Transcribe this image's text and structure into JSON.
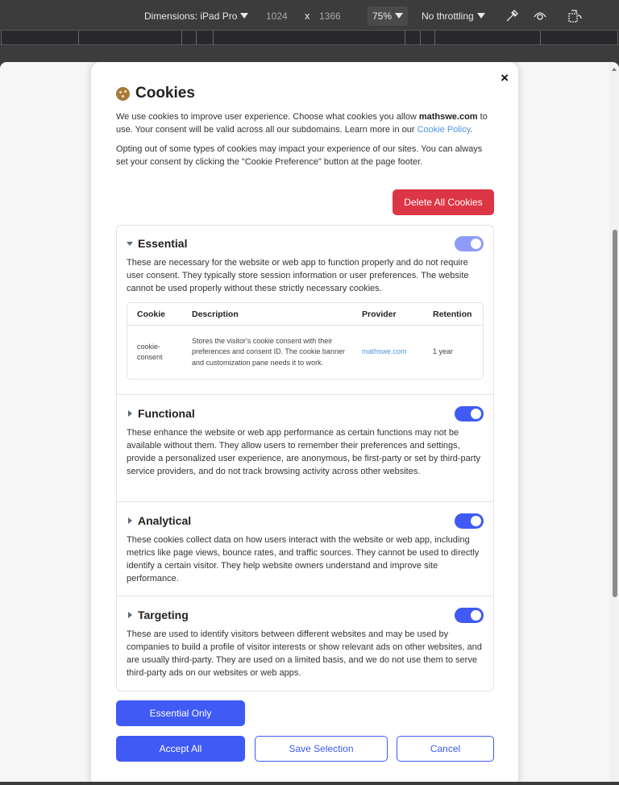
{
  "devtools": {
    "dimensions_label": "Dimensions: iPad Pro",
    "width": "1024",
    "times": "x",
    "height": "1366",
    "zoom": "75%",
    "throttling": "No throttling"
  },
  "modal": {
    "title": "Cookies",
    "close_label": "×",
    "intro_1_a": "We use cookies to improve user experience. Choose what cookies you allow ",
    "intro_1_domain": "mathswe.com",
    "intro_1_b": " to use. Your consent will be valid across all our subdomains. Learn more in our ",
    "intro_1_link": "Cookie Policy",
    "intro_1_c": ".",
    "intro_2": "Opting out of some types of cookies may impact your experience of our sites. You can always set your consent by clicking the \"Cookie Preference\" button at the page footer.",
    "delete_button": "Delete All Cookies",
    "categories": [
      {
        "name": "Essential",
        "expanded": true,
        "enabled": true,
        "toggle_disabled": true,
        "description": "These are necessary for the website or web app to function properly and do not require user consent. They typically store session information or user preferences. The website cannot be used properly without these strictly necessary cookies.",
        "table": {
          "headers": [
            "Cookie",
            "Description",
            "Provider",
            "Retention"
          ],
          "rows": [
            {
              "cookie": "cookie-consent",
              "description": "Stores the visitor's cookie consent with their preferences and consent ID. The cookie banner and customization pane needs it to work.",
              "provider": "mathswe.com",
              "retention": "1 year"
            }
          ]
        }
      },
      {
        "name": "Functional",
        "expanded": false,
        "enabled": true,
        "description": "These enhance the website or web app performance as certain functions may not be available without them. They allow users to remember their preferences and settings, provide a personalized user experience, are anonymous, be first-party or set by third-party service providers, and do not track browsing activity across other websites."
      },
      {
        "name": "Analytical",
        "expanded": false,
        "enabled": true,
        "description": "These cookies collect data on how users interact with the website or web app, including metrics like page views, bounce rates, and traffic sources. They cannot be used to directly identify a certain visitor. They help website owners understand and improve site performance."
      },
      {
        "name": "Targeting",
        "expanded": false,
        "enabled": true,
        "description": "These are used to identify visitors between different websites and may be used by companies to build a profile of visitor interests or show relevant ads on other websites, and are usually third-party. They are used on a limited basis, and we do not use them to serve third-party ads on our websites or web apps."
      }
    ],
    "buttons": {
      "essential_only": "Essential Only",
      "accept_all": "Accept All",
      "save_selection": "Save Selection",
      "cancel": "Cancel"
    }
  },
  "colors": {
    "primary": "#3f5af5",
    "danger": "#dc3545",
    "link": "#4e94e0",
    "cookie_icon": "#a87a3a"
  }
}
